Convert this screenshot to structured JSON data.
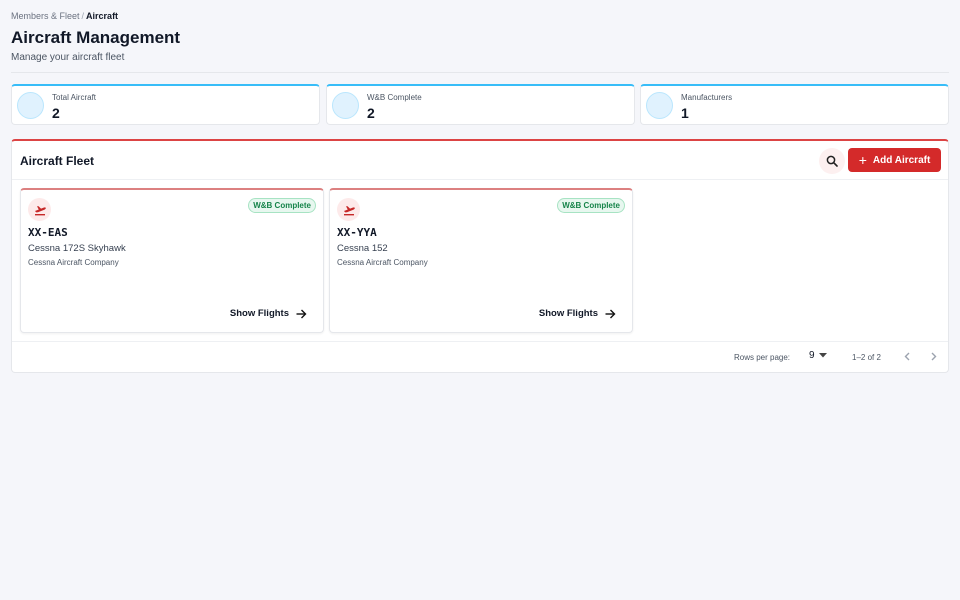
{
  "breadcrumb": {
    "parent": "Members & Fleet",
    "separator": "/",
    "current": "Aircraft"
  },
  "header": {
    "title": "Aircraft Management",
    "subtitle": "Manage your aircraft fleet"
  },
  "stats": [
    {
      "label": "Total Aircraft",
      "value": "2"
    },
    {
      "label": "W&B Complete",
      "value": "2"
    },
    {
      "label": "Manufacturers",
      "value": "1"
    }
  ],
  "fleet": {
    "title": "Aircraft Fleet",
    "add_label": "Add Aircraft",
    "aircraft": [
      {
        "registration": "XX-EAS",
        "model": "Cessna 172S Skyhawk",
        "manufacturer": "Cessna Aircraft Company",
        "badge": "W&B Complete",
        "action": "Show Flights"
      },
      {
        "registration": "XX-YYA",
        "model": "Cessna 152",
        "manufacturer": "Cessna Aircraft Company",
        "badge": "W&B Complete",
        "action": "Show Flights"
      }
    ]
  },
  "pagination": {
    "rows_label": "Rows per page:",
    "rows_value": "9",
    "range": "1–2 of 2"
  },
  "colors": {
    "accent": "#d42a2a",
    "stat_accent": "#38bdf8",
    "badge_green": "#16844a"
  },
  "icons": {
    "search": "search-icon",
    "add": "plus-icon",
    "aircraft": "airplane-icon",
    "arrow": "arrow-right-icon",
    "prev": "chevron-left-icon",
    "next": "chevron-right-icon",
    "dropdown": "caret-down-icon"
  }
}
